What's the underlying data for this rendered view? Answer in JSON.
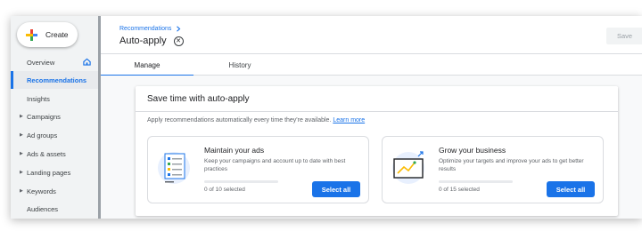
{
  "sidebar": {
    "create_label": "Create",
    "items": [
      {
        "label": "Overview",
        "caret": false,
        "active": false
      },
      {
        "label": "Recommendations",
        "caret": false,
        "active": true
      },
      {
        "label": "Insights",
        "caret": false,
        "active": false
      },
      {
        "label": "Campaigns",
        "caret": true,
        "active": false
      },
      {
        "label": "Ad groups",
        "caret": true,
        "active": false
      },
      {
        "label": "Ads & assets",
        "caret": true,
        "active": false
      },
      {
        "label": "Landing pages",
        "caret": true,
        "active": false
      },
      {
        "label": "Keywords",
        "caret": true,
        "active": false
      },
      {
        "label": "Audiences",
        "caret": false,
        "active": false
      }
    ]
  },
  "header": {
    "breadcrumb": "Recommendations",
    "title": "Auto-apply",
    "save_label": "Save"
  },
  "tabs": [
    {
      "label": "Manage",
      "active": true
    },
    {
      "label": "History",
      "active": false
    }
  ],
  "card": {
    "title": "Save time with auto-apply",
    "description": "Apply recommendations automatically every time they're available.",
    "learn_more": "Learn more",
    "options": [
      {
        "title": "Maintain your ads",
        "desc": "Keep your campaigns and account up to date with best practices",
        "count": "0 of 10 selected",
        "selected_fraction": 0,
        "button": "Select all"
      },
      {
        "title": "Grow your business",
        "desc": "Optimize your targets and improve your ads to get better results",
        "count": "0 of 15 selected",
        "selected_fraction": 0,
        "button": "Select all"
      }
    ]
  },
  "colors": {
    "accent": "#1a73e8",
    "sidebar_bg": "#f1f3f4"
  }
}
